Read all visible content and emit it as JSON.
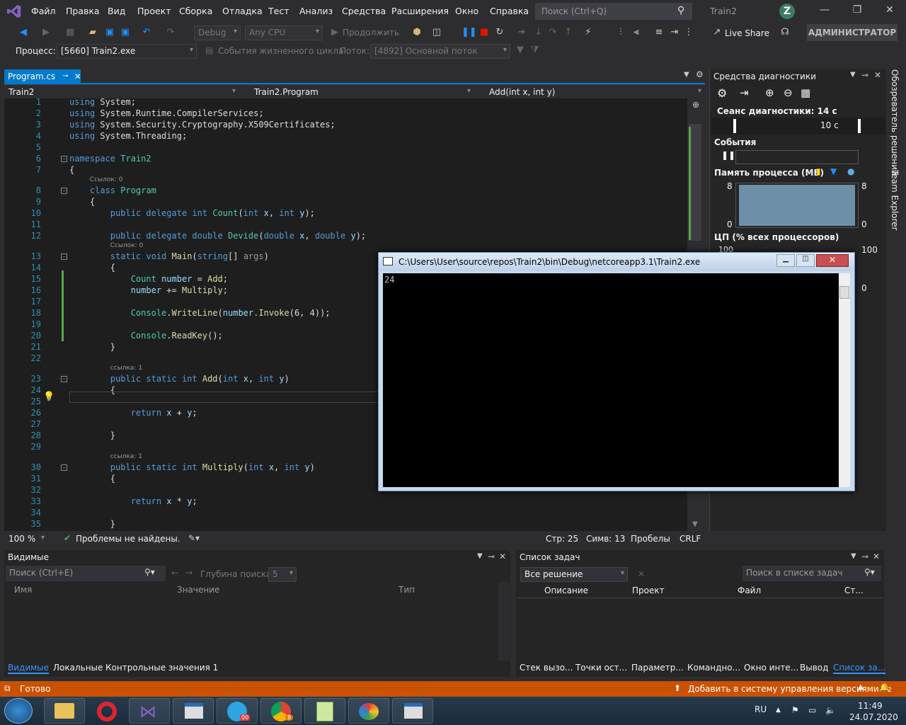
{
  "menu": {
    "items": [
      "Файл",
      "Правка",
      "Вид",
      "Проект",
      "Сборка",
      "Отладка",
      "Тест",
      "Анализ",
      "Средства",
      "Расширения",
      "Окно",
      "Справка"
    ],
    "search_placeholder": "Поиск (Ctrl+Q)",
    "solution_name": "Train2",
    "avatar_letter": "Z"
  },
  "toolbar": {
    "config": "Debug",
    "platform": "Any CPU",
    "continue_label": "Продолжить",
    "live_share": "Live Share",
    "admin": "АДМИНИСТРАТОР"
  },
  "process_bar": {
    "process_label": "Процесс:",
    "process_value": "[5660] Train2.exe",
    "lifecycle": "События жизненного цикла",
    "thread_label": "Поток:",
    "thread_value": "[4892] Основной поток"
  },
  "editor": {
    "tab_name": "Program.cs",
    "nav_project": "Train2",
    "nav_class": "Train2.Program",
    "nav_member": "Add(int x, int y)",
    "zoom": "100 %",
    "problems": "Проблемы не найдены.",
    "line_label": "Стр: 25",
    "col_label": "Симв: 13",
    "spaces": "Пробелы",
    "eol": "CRLF",
    "lines": [
      {
        "n": "1",
        "html": "<span class='kw'>using</span> System;"
      },
      {
        "n": "2",
        "html": "<span class='kw'>using</span> System.Runtime.CompilerServices;"
      },
      {
        "n": "3",
        "html": "<span class='kw'>using</span> System.Security.Cryptography.X509Certificates;"
      },
      {
        "n": "4",
        "html": "<span class='kw'>using</span> System.Threading;"
      },
      {
        "n": "5",
        "html": ""
      },
      {
        "n": "6",
        "html": "<span class='kw'>namespace</span> <span class='ty'>Train2</span>"
      },
      {
        "n": "7",
        "html": "{"
      },
      {
        "n": "8",
        "html": "    <span class='kw'>class</span> <span class='ty'>Program</span>",
        "lens": "Ссылок: 0"
      },
      {
        "n": "9",
        "html": "    {"
      },
      {
        "n": "10",
        "html": "        <span class='kw'>public delegate int</span> <span class='ty'>Count</span>(<span class='kw'>int</span> <span class='pm'>x</span>, <span class='kw'>int</span> <span class='pm'>y</span>);"
      },
      {
        "n": "11",
        "html": ""
      },
      {
        "n": "12",
        "html": "        <span class='kw'>public delegate double</span> <span class='ty'>Devide</span>(<span class='kw'>double</span> <span class='pm'>x</span>, <span class='kw'>double</span> <span class='pm'>y</span>);"
      },
      {
        "n": "13",
        "html": "        <span class='kw'>static void</span> <span class='mt'>Main</span>(<span class='kw'>string</span>[] <span class='cm'>args</span>)",
        "lens": "Ссылок: 0"
      },
      {
        "n": "14",
        "html": "        {"
      },
      {
        "n": "15",
        "html": "            <span class='ty'>Count</span> <span class='pm'>number</span> = <span class='mt'>Add</span>;"
      },
      {
        "n": "16",
        "html": "            <span class='pm'>number</span> += <span class='mt'>Multiply</span>;"
      },
      {
        "n": "17",
        "html": ""
      },
      {
        "n": "18",
        "html": "            <span class='ty'>Console</span>.<span class='mt'>WriteLine</span>(<span class='pm'>number</span>.<span class='mt'>Invoke</span>(6, 4));"
      },
      {
        "n": "19",
        "html": ""
      },
      {
        "n": "20",
        "html": "            <span class='ty'>Console</span>.<span class='mt'>ReadKey</span>();"
      },
      {
        "n": "21",
        "html": "        }"
      },
      {
        "n": "22",
        "html": ""
      },
      {
        "n": "23",
        "html": "        <span class='kw'>public static int</span> <span class='mt'>Add</span>(<span class='kw'>int</span> <span class='pm'>x</span>, <span class='kw'>int</span> <span class='pm'>y</span>)",
        "lens": "ссылка: 1"
      },
      {
        "n": "24",
        "html": "        {"
      },
      {
        "n": "25",
        "html": ""
      },
      {
        "n": "26",
        "html": "            <span class='kw'>return</span> <span class='pm'>x</span> + <span class='pm'>y</span>;"
      },
      {
        "n": "27",
        "html": ""
      },
      {
        "n": "28",
        "html": "        }"
      },
      {
        "n": "29",
        "html": ""
      },
      {
        "n": "30",
        "html": "        <span class='kw'>public static int</span> <span class='mt'>Multiply</span>(<span class='kw'>int</span> <span class='pm'>x</span>, <span class='kw'>int</span> <span class='pm'>y</span>)",
        "lens": "ссылка: 1"
      },
      {
        "n": "31",
        "html": "        {"
      },
      {
        "n": "32",
        "html": ""
      },
      {
        "n": "33",
        "html": "            <span class='kw'>return</span> <span class='pm'>x</span> * <span class='pm'>y</span>;"
      },
      {
        "n": "34",
        "html": ""
      },
      {
        "n": "35",
        "html": "        }"
      }
    ]
  },
  "diagnostics": {
    "title": "Средства диагностики",
    "session": "Сеанс диагностики: 14 с",
    "time_tick": "10 с",
    "events": "События",
    "memory": "Память процесса (МБ)",
    "mem_max": "8",
    "mem_min": "0",
    "cpu": "ЦП (% всех процессоров)",
    "cpu_max": "100",
    "cpu_min": "0",
    "side_tab_1": "Обозреватель решений",
    "side_tab_2": "Team Explorer"
  },
  "console": {
    "title": "C:\\Users\\User\\source\\repos\\Train2\\bin\\Debug\\netcoreapp3.1\\Train2.exe",
    "output": "24"
  },
  "locals": {
    "title": "Видимые",
    "search_placeholder": "Поиск (Ctrl+E)",
    "depth_label": "Глубина поиска:",
    "depth_value": "5",
    "col_name": "Имя",
    "col_value": "Значение",
    "col_type": "Тип",
    "tabs": [
      "Видимые",
      "Локальные",
      "Контрольные значения 1"
    ]
  },
  "tasks": {
    "title": "Список задач",
    "scope": "Все решение",
    "search_placeholder": "Поиск в списке задач",
    "col_desc": "Описание",
    "col_project": "Проект",
    "col_file": "Файл",
    "col_line": "Ст...",
    "tabs": [
      "Стек вызо...",
      "Точки ост...",
      "Параметр...",
      "Командно...",
      "Окно инте...",
      "Вывод",
      "Список за..."
    ]
  },
  "status": {
    "ready": "Готово",
    "source_control": "Добавить в систему управления версиями",
    "notif_count": "2"
  },
  "taskbar": {
    "lang": "RU",
    "time": "11:49",
    "date": "24.07.2020",
    "telegram_badge": "00",
    "chrome_badge": "8"
  },
  "colors": {
    "accent": "#007acc",
    "status": "#ca5100"
  }
}
